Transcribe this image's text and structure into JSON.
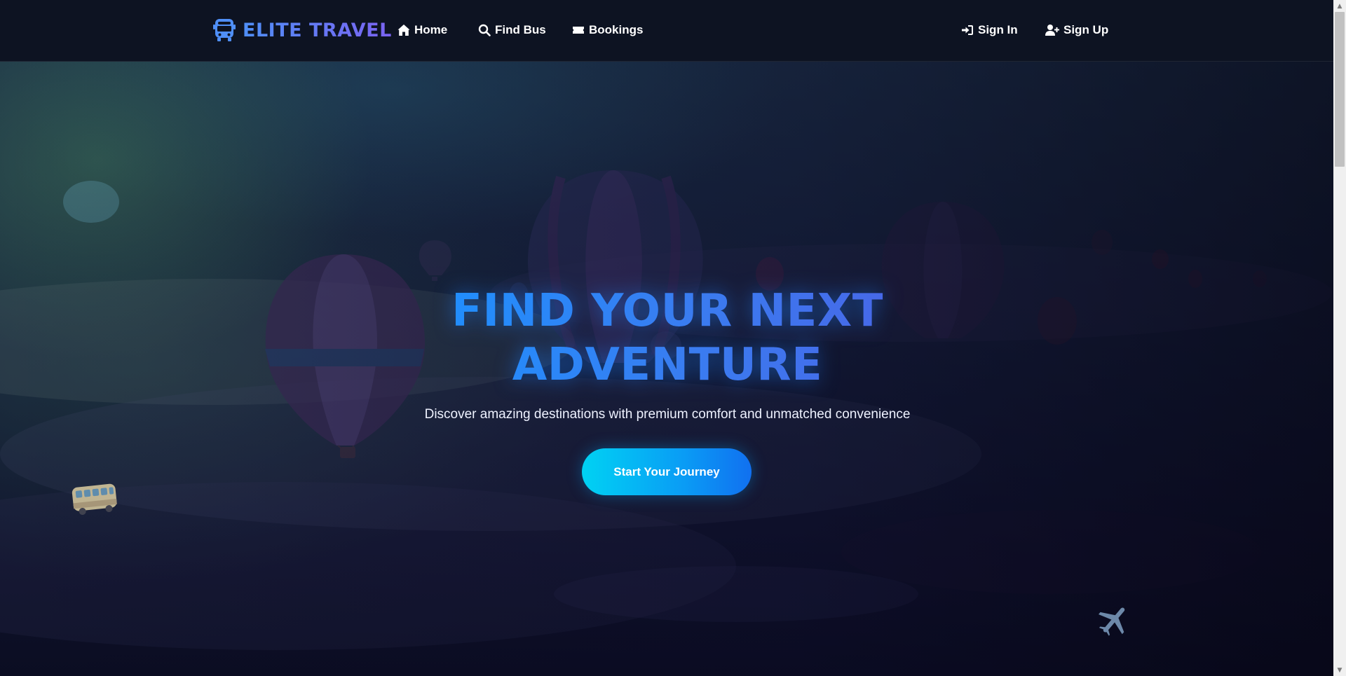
{
  "nav": {
    "brand": "ELITE TRAVEL",
    "brand_icon": "bus-icon",
    "links": [
      {
        "label": "Home",
        "icon": "home-icon"
      },
      {
        "label": "Find Bus",
        "icon": "search-icon"
      },
      {
        "label": "Bookings",
        "icon": "ticket-icon"
      }
    ],
    "auth": [
      {
        "label": "Sign In",
        "icon": "sign-in-icon"
      },
      {
        "label": "Sign Up",
        "icon": "user-plus-icon"
      }
    ]
  },
  "hero": {
    "title_line1": "FIND YOUR NEXT",
    "title_line2": "ADVENTURE",
    "subtitle": "Discover amazing destinations with premium comfort and unmatched convenience",
    "cta_label": "Start Your Journey",
    "background": "hot-air-balloons-over-clouds",
    "floating_icons": [
      "bus-emoji-icon",
      "airplane-emoji-icon"
    ]
  },
  "colors": {
    "brand_gradient_start": "#4f8ff7",
    "brand_gradient_end": "#7b63f2",
    "title_gradient_start": "#1b92ff",
    "title_gradient_end": "#4a63e6",
    "cta_gradient_start": "#00d2f3",
    "cta_gradient_end": "#1170f0",
    "navbar_bg": "#0d1322"
  }
}
